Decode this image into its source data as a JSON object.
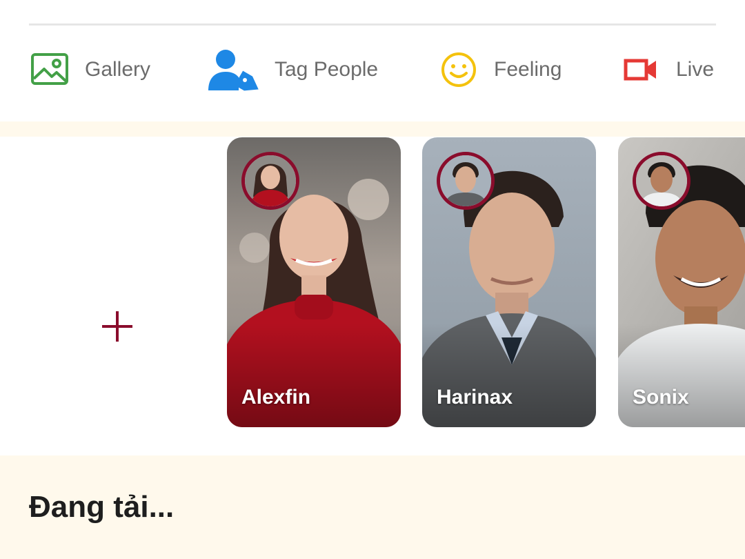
{
  "composer_actions": [
    {
      "label": "Gallery",
      "icon": "image-icon",
      "color": "#43a047"
    },
    {
      "label": "Tag People",
      "icon": "tag-people-icon",
      "color": "#1e88e5"
    },
    {
      "label": "Feeling",
      "icon": "smiley-icon",
      "color": "#f4c20d"
    },
    {
      "label": "Live",
      "icon": "video-camera-icon",
      "color": "#e53935"
    }
  ],
  "stories": {
    "add_icon": "plus-icon",
    "items": [
      {
        "name": "Alexfin"
      },
      {
        "name": "Harinax"
      },
      {
        "name": "Sonix"
      }
    ]
  },
  "feed": {
    "status": "Đang tải..."
  },
  "colors": {
    "accent": "#8a0c2c",
    "band_background": "#fff9ec"
  }
}
